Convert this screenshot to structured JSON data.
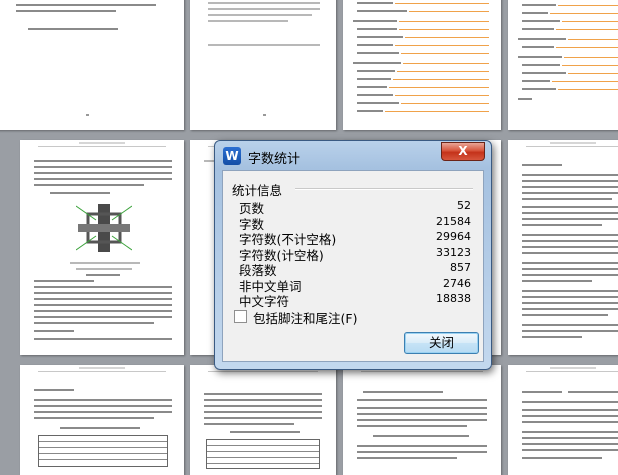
{
  "dialog": {
    "title": "字数统计",
    "app_icon_letter": "W",
    "close_glyph": "X",
    "group_title": "统计信息",
    "stats": [
      {
        "label": "页数",
        "value": "52"
      },
      {
        "label": "字数",
        "value": "21584"
      },
      {
        "label": "字符数(不计空格)",
        "value": "29964"
      },
      {
        "label": "字符数(计空格)",
        "value": "33123"
      },
      {
        "label": "段落数",
        "value": "857"
      },
      {
        "label": "非中文单词",
        "value": "2746"
      },
      {
        "label": "中文字符",
        "value": "18838"
      }
    ],
    "checkbox_label": "包括脚注和尾注(F)",
    "checkbox_checked": false,
    "ok_label": "关闭"
  },
  "colors": {
    "workspace": "#9a9ea4",
    "titlebar": "#b9d1ea",
    "close_button": "#c4321a",
    "toc_leader": "#f0a24a"
  }
}
